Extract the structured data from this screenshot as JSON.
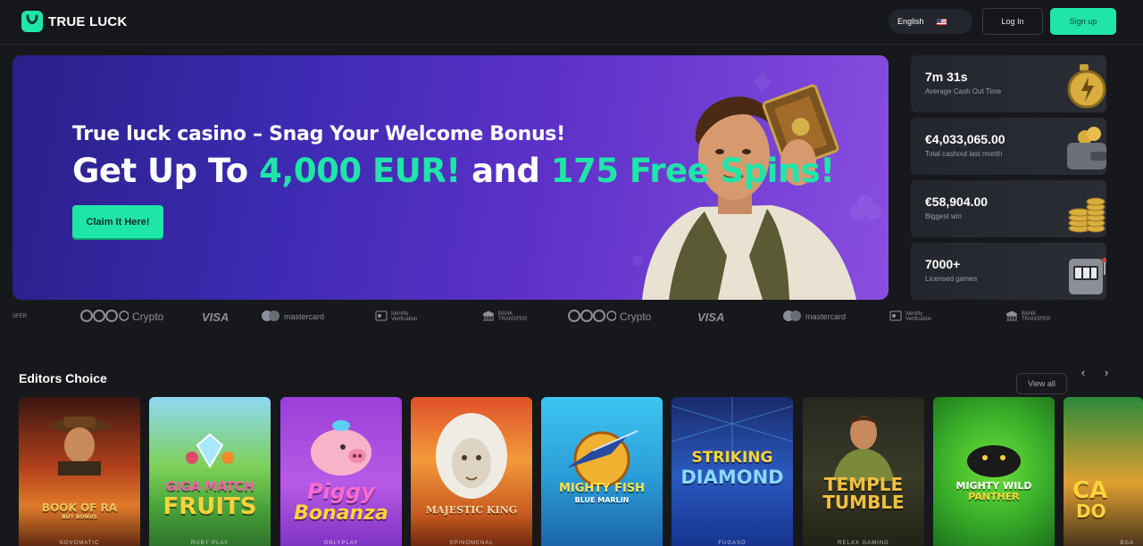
{
  "header": {
    "brand": "TRUE LUCK",
    "language": "English",
    "login_label": "Log In",
    "signup_label": "Sign up"
  },
  "hero": {
    "subtitle": "True luck casino – Snag Your Welcome Bonus!",
    "title_part1": "Get Up To ",
    "title_amount": "4,000 EUR!",
    "title_part2": " and ",
    "title_spins": "175 Free Spins!",
    "cta_label": "Claim It Here!"
  },
  "stats": [
    {
      "value": "7m 31s",
      "label": "Average Cash Out Time",
      "icon": "stopwatch-icon"
    },
    {
      "value": "€4,033,065.00",
      "label": "Total cashout last month",
      "icon": "wallet-icon"
    },
    {
      "value": "€58,904.00",
      "label": "Biggest win",
      "icon": "coins-icon"
    },
    {
      "value": "7000+",
      "label": "Licensed games",
      "icon": "slot-machine-icon"
    }
  ],
  "payments": {
    "crypto": "Crypto",
    "visa": "VISA",
    "mastercard": "mastercard",
    "identity_line1": "Identity",
    "identity_line2": "Verification",
    "bank_line1": "BANK",
    "bank_line2": "TRANSFER",
    "bank_partial": "SFER"
  },
  "editors_choice": {
    "title": "Editors Choice",
    "view_all_label": "View all",
    "games": [
      {
        "name_line1": "BOOK OF RA",
        "name_line2": "BUY BONUS",
        "provider": "NOVOMATIC"
      },
      {
        "name_line1": "GIGA MATCH",
        "name_line2": "FRUITS",
        "provider": "RUBY PLAY"
      },
      {
        "name_line1": "Piggy",
        "name_line2": "Bonanza",
        "provider": "ONLYPLAY"
      },
      {
        "name_line1": "MAJESTIC KING",
        "name_line2": "",
        "provider": "SPINOMENAL"
      },
      {
        "name_line1": "MIGHTY FISH",
        "name_line2": "BLUE MARLIN",
        "provider": ""
      },
      {
        "name_line1": "STRIKING",
        "name_line2": "DIAMOND",
        "provider": "FUGASO"
      },
      {
        "name_line1": "TEMPLE",
        "name_line2": "TUMBLE",
        "provider": "RELAX GAMING"
      },
      {
        "name_line1": "MIGHTY WILD",
        "name_line2": "PANTHER",
        "provider": ""
      },
      {
        "name_line1": "CA",
        "name_line2": "DO",
        "provider": "BGA"
      }
    ]
  },
  "colors": {
    "accent": "#1fe5a8",
    "background": "#17181c",
    "card": "#24262d"
  }
}
